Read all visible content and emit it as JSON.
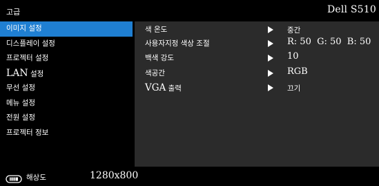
{
  "header": {
    "menu_title": "고급",
    "model": "Dell S510"
  },
  "sidebar": {
    "items": [
      {
        "label": "이미지 설정",
        "active": true
      },
      {
        "label": "디스플레이 설정"
      },
      {
        "label": "프로젝터 설정"
      },
      {
        "label_prefix": "LAN",
        "label_suffix": " 설정"
      },
      {
        "label": "무선 설정"
      },
      {
        "label": "메뉴 설정"
      },
      {
        "label": "전원 설정"
      },
      {
        "label": "프로젝터 정보"
      }
    ]
  },
  "settings": {
    "rows": [
      {
        "label": "색 온도",
        "value": "중간"
      },
      {
        "label": "사용자지정 색상 조절",
        "value": "R: 50  G: 50  B: 50"
      },
      {
        "label": "백색 강도",
        "value": "10"
      },
      {
        "label": "색공간",
        "value": "RGB"
      },
      {
        "label_prefix": "VGA",
        "label_suffix": " 출력",
        "value": "끄기"
      }
    ]
  },
  "footer": {
    "resolution_icon": "display-resolution-icon",
    "resolution_label": "해상도",
    "resolution_value": "1280x800"
  },
  "colors": {
    "accent": "#1f7fd2",
    "panel": "#2b2b2b",
    "background": "#000000"
  }
}
